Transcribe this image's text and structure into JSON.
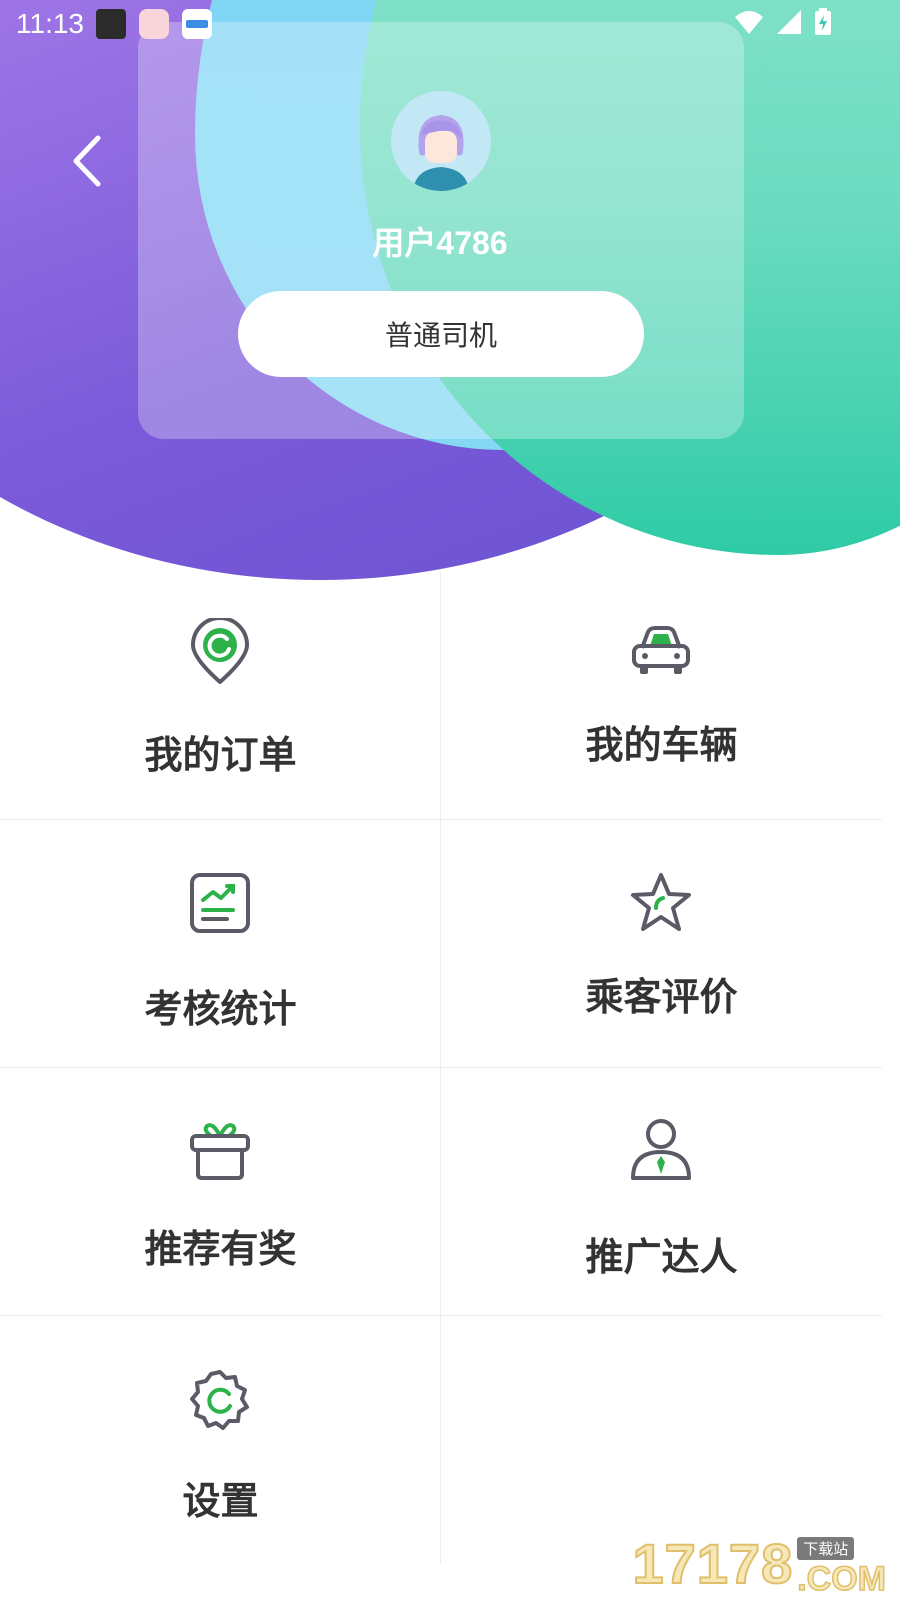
{
  "status_bar": {
    "time": "11:13",
    "apps": [
      "clock-app-icon",
      "food-app-icon",
      "travel-app-icon"
    ],
    "indicators": [
      "wifi-icon",
      "signal-icon",
      "battery-charging-icon"
    ]
  },
  "profile": {
    "username": "用户4786",
    "role": "普通司机"
  },
  "menu": {
    "items": [
      {
        "label": "我的订单",
        "icon": "order-location-icon"
      },
      {
        "label": "我的车辆",
        "icon": "car-icon"
      },
      {
        "label": "考核统计",
        "icon": "stats-chart-icon"
      },
      {
        "label": "乘客评价",
        "icon": "star-icon"
      },
      {
        "label": "推荐有奖",
        "icon": "gift-icon"
      },
      {
        "label": "推广达人",
        "icon": "person-tie-icon"
      },
      {
        "label": "设置",
        "icon": "settings-gear-icon"
      }
    ]
  },
  "watermark": {
    "number": "17178",
    "tag": "下载站",
    "domain": ".COM"
  },
  "colors": {
    "accent_green": "#2db24a",
    "icon_gray": "#5a5b66",
    "purple_bg": "#7a5ad9",
    "teal_bg": "#2fcba6",
    "blue_bg": "#7fd5f7"
  }
}
